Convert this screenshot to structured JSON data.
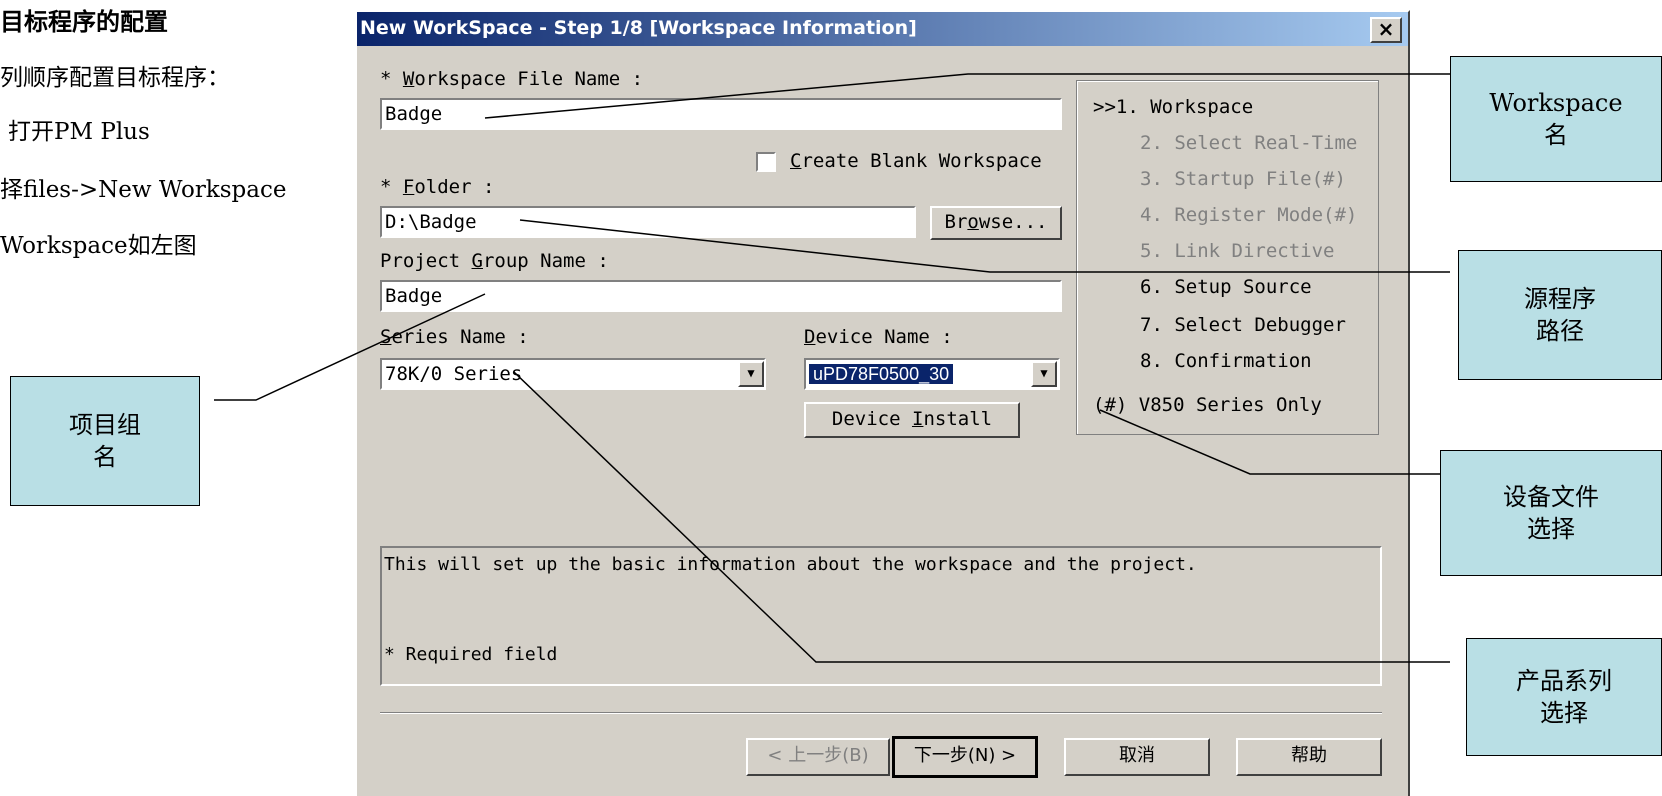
{
  "slide": {
    "title": "目标程序的配置",
    "lines": [
      "列顺序配置目标程序：",
      "打开PM Plus",
      "择files->New Workspace",
      "Workspace如左图"
    ]
  },
  "dialog": {
    "title": "New WorkSpace - Step 1/8 [Workspace Information]",
    "close_label": "×",
    "workspace_file_label_prefix": "* ",
    "workspace_file_label_key": "W",
    "workspace_file_label_rest": "orkspace File Name :",
    "workspace_file_value": "Badge",
    "create_blank_key": "C",
    "create_blank_rest": "reate Blank Workspace",
    "folder_label_prefix": "* ",
    "folder_label_key": "F",
    "folder_label_rest": "older :",
    "folder_value": "D:\\Badge",
    "browse_pre": "Br",
    "browse_key": "o",
    "browse_post": "wse...",
    "project_group_label_pre": "Project ",
    "project_group_label_key": "G",
    "project_group_label_rest": "roup Name :",
    "project_group_value": "Badge",
    "series_label_key": "S",
    "series_label_rest": "eries Name :",
    "series_value": "78K/0 Series",
    "device_label_key": "D",
    "device_label_rest": "evice Name :",
    "device_value": "uPD78F0500_30",
    "device_install_pre": "Device ",
    "device_install_key": "I",
    "device_install_post": "nstall",
    "steps": [
      ">>1. Workspace",
      "2. Select Real-Time",
      "3. Startup File(#)",
      "4. Register Mode(#)",
      "5. Link Directive",
      "6. Setup Source",
      "7. Select Debugger",
      "8. Confirmation"
    ],
    "steps_note": "(#) V850 Series Only",
    "info_text": "This will set up the basic information about the workspace and the project.",
    "required_note": "* Required field",
    "btn_back": "< 上一步(B)",
    "btn_next": "下一步(N) >",
    "btn_cancel": "取消",
    "btn_help": "帮助"
  },
  "callouts": {
    "workspace_line1": "Workspace",
    "workspace_line2": "名",
    "source_line1": "源程序",
    "source_line2": "路径",
    "device_line1": "设备文件",
    "device_line2": "选择",
    "series_line1": "产品系列",
    "series_line2": "选择",
    "project_line1": "项目组",
    "project_line2": "名"
  }
}
